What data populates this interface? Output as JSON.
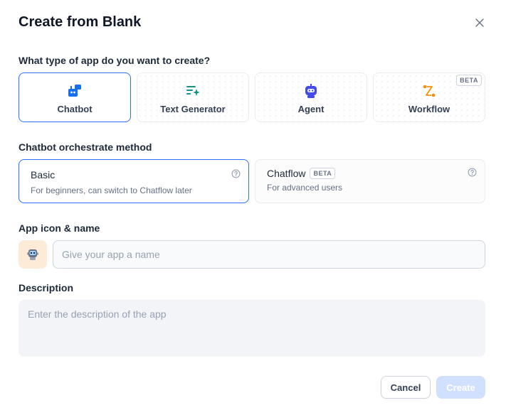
{
  "dialog": {
    "title": "Create from Blank",
    "close_icon": "close-icon"
  },
  "app_type": {
    "label": "What type of app do you want to create?",
    "options": [
      {
        "label": "Chatbot",
        "icon": "chatbot-icon",
        "selected": true
      },
      {
        "label": "Text Generator",
        "icon": "text-generator-icon",
        "selected": false
      },
      {
        "label": "Agent",
        "icon": "agent-icon",
        "selected": false
      },
      {
        "label": "Workflow",
        "icon": "workflow-icon",
        "selected": false,
        "badge": "BETA"
      }
    ]
  },
  "orchestrate": {
    "label": "Chatbot orchestrate method",
    "options": [
      {
        "title": "Basic",
        "description": "For beginners, can switch to Chatflow later",
        "selected": true
      },
      {
        "title": "Chatflow",
        "badge": "BETA",
        "description": "For advanced users",
        "selected": false
      }
    ]
  },
  "app_icon_name": {
    "label": "App icon & name",
    "placeholder": "Give your app a name",
    "value": ""
  },
  "description": {
    "label": "Description",
    "placeholder": "Enter the description of the app",
    "value": ""
  },
  "footer": {
    "cancel_label": "Cancel",
    "create_label": "Create"
  },
  "colors": {
    "accent": "#2970ff",
    "create_disabled": "#d1e0ff",
    "chatbot_icon": "#1570ef",
    "text_gen_icon": "#0e9384",
    "agent_icon": "#444ce7",
    "workflow_icon": "#f79009"
  }
}
